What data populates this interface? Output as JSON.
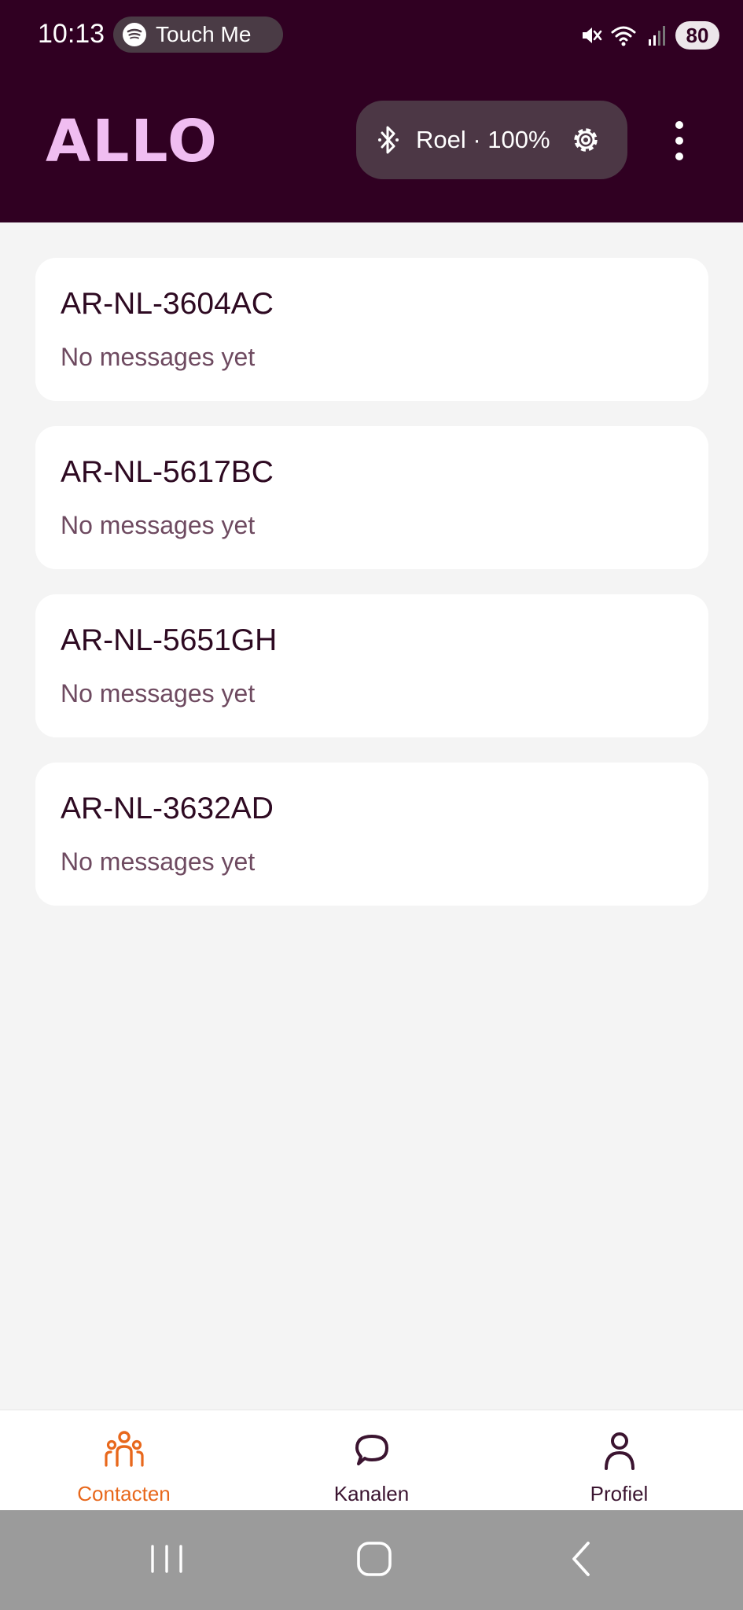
{
  "status_bar": {
    "time": "10:13",
    "media_title": "Touch Me",
    "battery": "80"
  },
  "header": {
    "logo": "ALLO",
    "device_label": "Roel · 100%"
  },
  "contacts": [
    {
      "name": "AR-NL-3604AC",
      "preview": "No messages yet"
    },
    {
      "name": "AR-NL-5617BC",
      "preview": "No messages yet"
    },
    {
      "name": "AR-NL-5651GH",
      "preview": "No messages yet"
    },
    {
      "name": "AR-NL-3632AD",
      "preview": "No messages yet"
    }
  ],
  "bottom_nav": {
    "items": [
      {
        "label": "Contacten",
        "icon": "people-icon",
        "active": true
      },
      {
        "label": "Kanalen",
        "icon": "chat-bubble-icon",
        "active": false
      },
      {
        "label": "Profiel",
        "icon": "person-icon",
        "active": false
      }
    ]
  },
  "system_nav": {
    "icons": [
      "recents-icon",
      "home-icon",
      "back-icon"
    ]
  },
  "colors": {
    "header_bg": "#300022",
    "logo": "#f0bdf1",
    "accent": "#e8681c",
    "page_bg": "#f4f4f4"
  }
}
